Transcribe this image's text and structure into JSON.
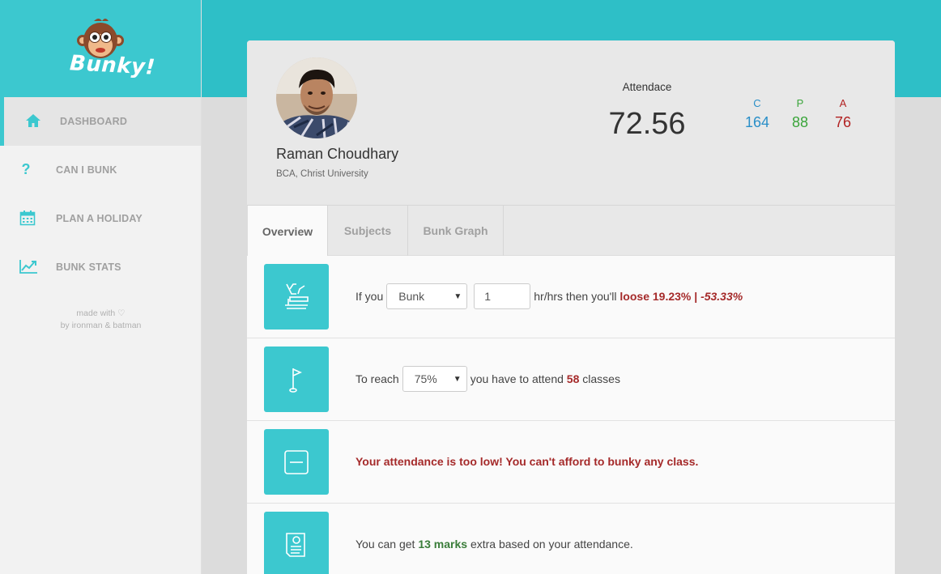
{
  "app": {
    "logo_text": "Bunky!",
    "accent": "#3cc8cf"
  },
  "sidebar": {
    "items": [
      {
        "label": "DASHBOARD",
        "icon": "home-icon",
        "active": true
      },
      {
        "label": "CAN I BUNK",
        "icon": "question-icon",
        "active": false
      },
      {
        "label": "PLAN A HOLIDAY",
        "icon": "calendar-icon",
        "active": false
      },
      {
        "label": "BUNK STATS",
        "icon": "line-chart-icon",
        "active": false
      }
    ],
    "credits_line1": "made with",
    "credits_line2": "by ironman & batman"
  },
  "profile": {
    "name": "Raman Choudhary",
    "subtitle": "BCA, Christ University",
    "attendance_label": "Attendace",
    "attendance_value": "72.56",
    "stats": [
      {
        "key": "C",
        "value": "164",
        "color": "#2a8fc8"
      },
      {
        "key": "P",
        "value": "88",
        "color": "#3aa53a"
      },
      {
        "key": "A",
        "value": "76",
        "color": "#b22222"
      }
    ]
  },
  "tabs": [
    {
      "label": "Overview",
      "active": true
    },
    {
      "label": "Subjects",
      "active": false
    },
    {
      "label": "Bunk Graph",
      "active": false
    }
  ],
  "rows": {
    "bunk": {
      "prefix": "If you",
      "select_value": "Bunk",
      "hours_value": "1",
      "middle": "hr/hrs then you'll",
      "loose_label": "loose 19.23%",
      "separator": " | ",
      "delta": "-53.33%",
      "icon": "person-bunking-icon"
    },
    "reach": {
      "prefix": "To reach",
      "select_value": "75%",
      "middle": "you have to attend",
      "count": "58",
      "suffix": "classes",
      "icon": "flag-icon"
    },
    "warning": {
      "text": "Your attendance is too low! You can't afford to bunky any class.",
      "icon": "minus-box-icon"
    },
    "marks": {
      "prefix": "You can get",
      "marks": "13 marks",
      "suffix": "extra based on your attendance.",
      "icon": "document-icon"
    }
  }
}
